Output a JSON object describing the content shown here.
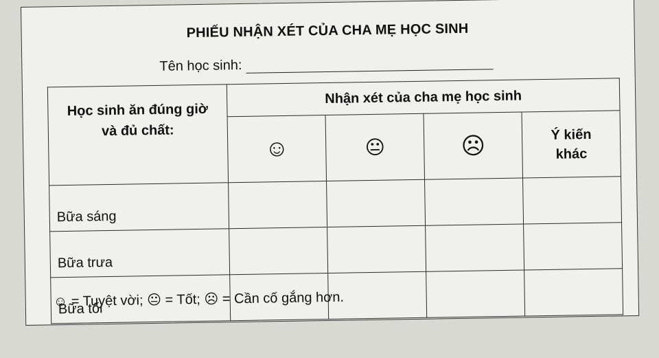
{
  "form": {
    "title": "PHIẾU NHẬN XÉT CỦA CHA MẸ HỌC SINH",
    "student_label": "Tên học sinh:",
    "table": {
      "left_header": [
        "Học sinh ăn đúng giờ",
        "và đủ chất:"
      ],
      "top_header": "Nhận xét của cha mẹ học sinh",
      "faces": [
        {
          "icon": "smile-face-icon",
          "glyph": "☺"
        },
        {
          "icon": "neutral-face-icon",
          "glyph": "😐"
        },
        {
          "icon": "sad-face-icon",
          "glyph": "☹"
        }
      ],
      "other_header": [
        "Ý kiến",
        "khác"
      ],
      "rows": [
        "Bữa sáng",
        "Bữa trưa",
        "Bữa tối"
      ]
    },
    "legend": {
      "great_glyph": "☺",
      "great": "= Tuyệt vời;",
      "good_glyph": "😐",
      "good": "= Tốt;",
      "try_glyph": "☹",
      "try": "= Cần cố gắng hơn."
    }
  }
}
